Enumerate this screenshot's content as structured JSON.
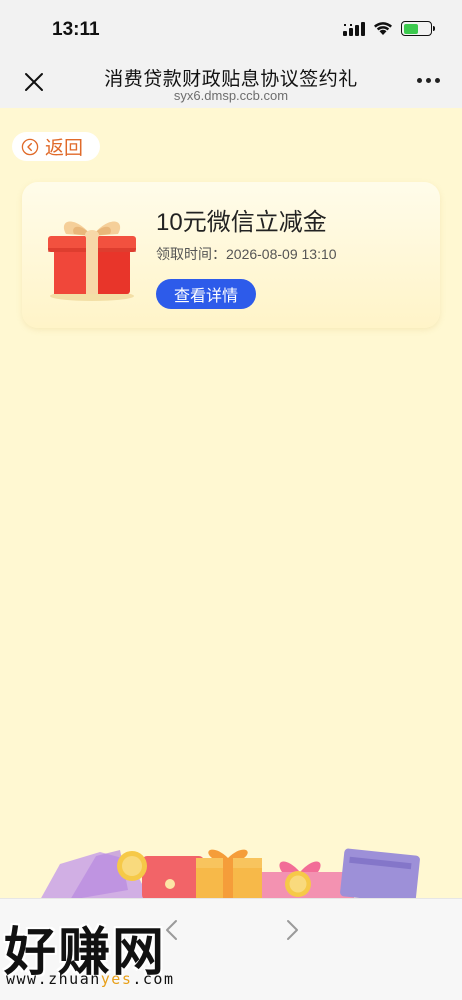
{
  "status_bar": {
    "time": "13:11",
    "battery_level": 0.55,
    "battery_color": "#3cc94e"
  },
  "nav": {
    "title": "消费贷款财政贴息协议签约礼",
    "domain": "syx6.dmsp.ccb.com",
    "close_icon": "close-icon",
    "more_icon": "more-dots-icon"
  },
  "back": {
    "label": "返回",
    "color": "#e06a2a"
  },
  "reward": {
    "title": "10元微信立减金",
    "time_label": "领取时间：2026-08-09 13:10",
    "button_label": "查看详情",
    "button_color": "#2d5bea"
  },
  "watermark": {
    "brand": "好赚网",
    "url_prefix": "www.zhuan",
    "url_highlight": "yes",
    "url_suffix": ".com"
  },
  "colors": {
    "page_background": "#fff8d2",
    "accent": "#2d5bea"
  }
}
